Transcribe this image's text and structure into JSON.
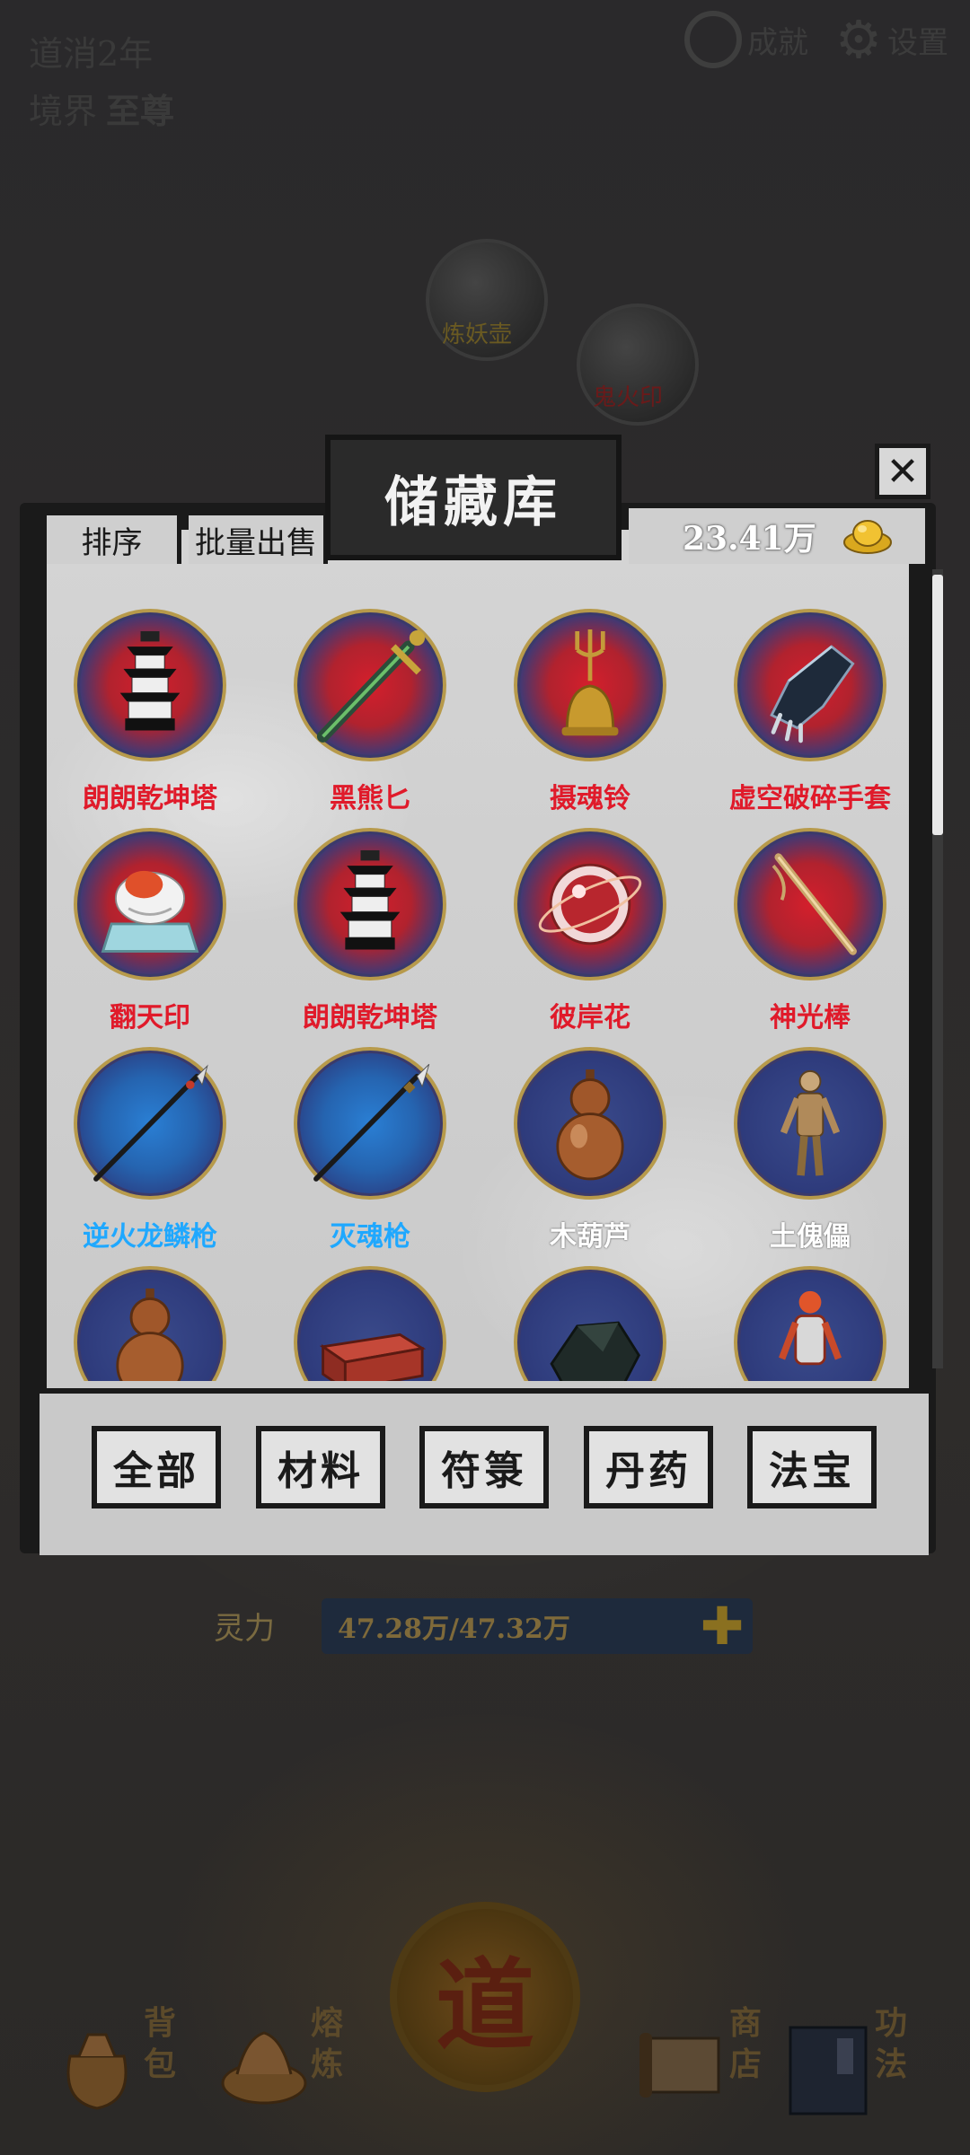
{
  "status": {
    "era": "道消2年",
    "realm_label": "境界",
    "realm_value": "至尊"
  },
  "top_buttons": {
    "achievements": "成就",
    "settings": "设置"
  },
  "world_nodes": [
    {
      "label": "炼妖壶"
    },
    {
      "label": "鬼火印"
    }
  ],
  "modal": {
    "title": "储藏库",
    "close_icon": "close-icon",
    "sort_label": "排序",
    "bulk_sell_label": "批量出售",
    "currency_value": "23.41万",
    "currency_icon": "gold-ingot-icon"
  },
  "items": [
    {
      "name": "朗朗乾坤塔",
      "rarity": "red",
      "icon": "pagoda-icon"
    },
    {
      "name": "黑熊匕",
      "rarity": "red",
      "icon": "dagger-icon"
    },
    {
      "name": "摄魂铃",
      "rarity": "red",
      "icon": "bell-icon"
    },
    {
      "name": "虚空破碎手套",
      "rarity": "red",
      "icon": "gauntlet-icon"
    },
    {
      "name": "翻天印",
      "rarity": "red",
      "icon": "seal-icon"
    },
    {
      "name": "朗朗乾坤塔",
      "rarity": "red",
      "icon": "pagoda-icon"
    },
    {
      "name": "彼岸花",
      "rarity": "red",
      "icon": "orb-icon"
    },
    {
      "name": "神光棒",
      "rarity": "red",
      "icon": "staff-icon"
    },
    {
      "name": "逆火龙鳞枪",
      "rarity": "blue",
      "icon": "spear-icon"
    },
    {
      "name": "灭魂枪",
      "rarity": "blue",
      "icon": "spear-icon"
    },
    {
      "name": "木葫芦",
      "rarity": "white",
      "icon": "gourd-icon"
    },
    {
      "name": "土傀儡",
      "rarity": "white",
      "icon": "puppet-icon"
    },
    {
      "name": "",
      "rarity": "white",
      "icon": "gourd-icon"
    },
    {
      "name": "",
      "rarity": "white",
      "icon": "brick-icon"
    },
    {
      "name": "",
      "rarity": "white",
      "icon": "ore-icon"
    },
    {
      "name": "",
      "rarity": "white",
      "icon": "figure-icon"
    }
  ],
  "tabs": [
    {
      "label": "全部"
    },
    {
      "label": "材料"
    },
    {
      "label": "符箓"
    },
    {
      "label": "丹药"
    },
    {
      "label": "法宝"
    }
  ],
  "spirit": {
    "label": "灵力",
    "value": "47.28万/47.32万"
  },
  "center_seal": "道",
  "bottom_nav": [
    {
      "label": "背包",
      "icon": "bag-icon"
    },
    {
      "label": "熔炼",
      "icon": "lotus-icon"
    },
    {
      "label": "商店",
      "icon": "scroll-icon"
    },
    {
      "label": "功法",
      "icon": "book-icon"
    }
  ],
  "colors": {
    "rarity_red": "#e01a2a",
    "rarity_blue": "#1fa8ff",
    "rarity_white": "#ffffff",
    "modal_frame": "#1a1a1a",
    "modal_paper": "#cfcfcf"
  }
}
